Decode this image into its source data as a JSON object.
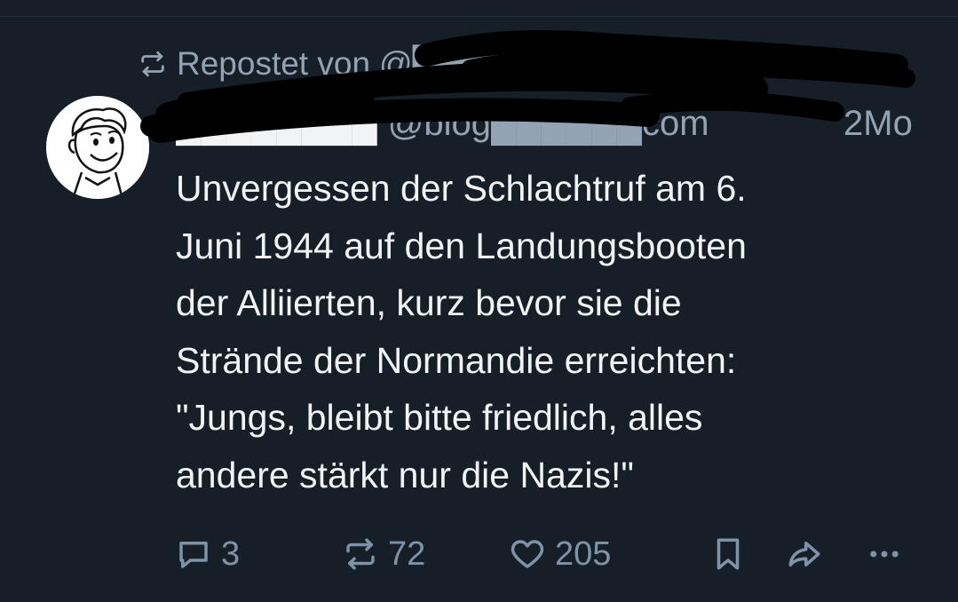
{
  "repost": {
    "icon": "repost-icon",
    "label": "Repostet von",
    "handle": "@████████go.bsky.social"
  },
  "post": {
    "author_name": "████████",
    "author_handle": "@blog██████com",
    "time": "2Mo",
    "text": "Unvergessen der Schlachtruf am 6.\nJuni 1944 auf den Landungsbooten\nder Alliierten, kurz bevor sie die\nStrände der Normandie erreichten:\n\"Jungs, bleibt bitte friedlich, alles\nandere stärkt nur die Nazis!\"",
    "avatar_icon": "vault-boy-avatar"
  },
  "actions": {
    "reply_count": "3",
    "repost_count": "72",
    "like_count": "205"
  },
  "colors": {
    "background": "#161e27",
    "text": "#f1f3f5",
    "muted": "#93a3b3",
    "icons": "#7f93a8"
  }
}
